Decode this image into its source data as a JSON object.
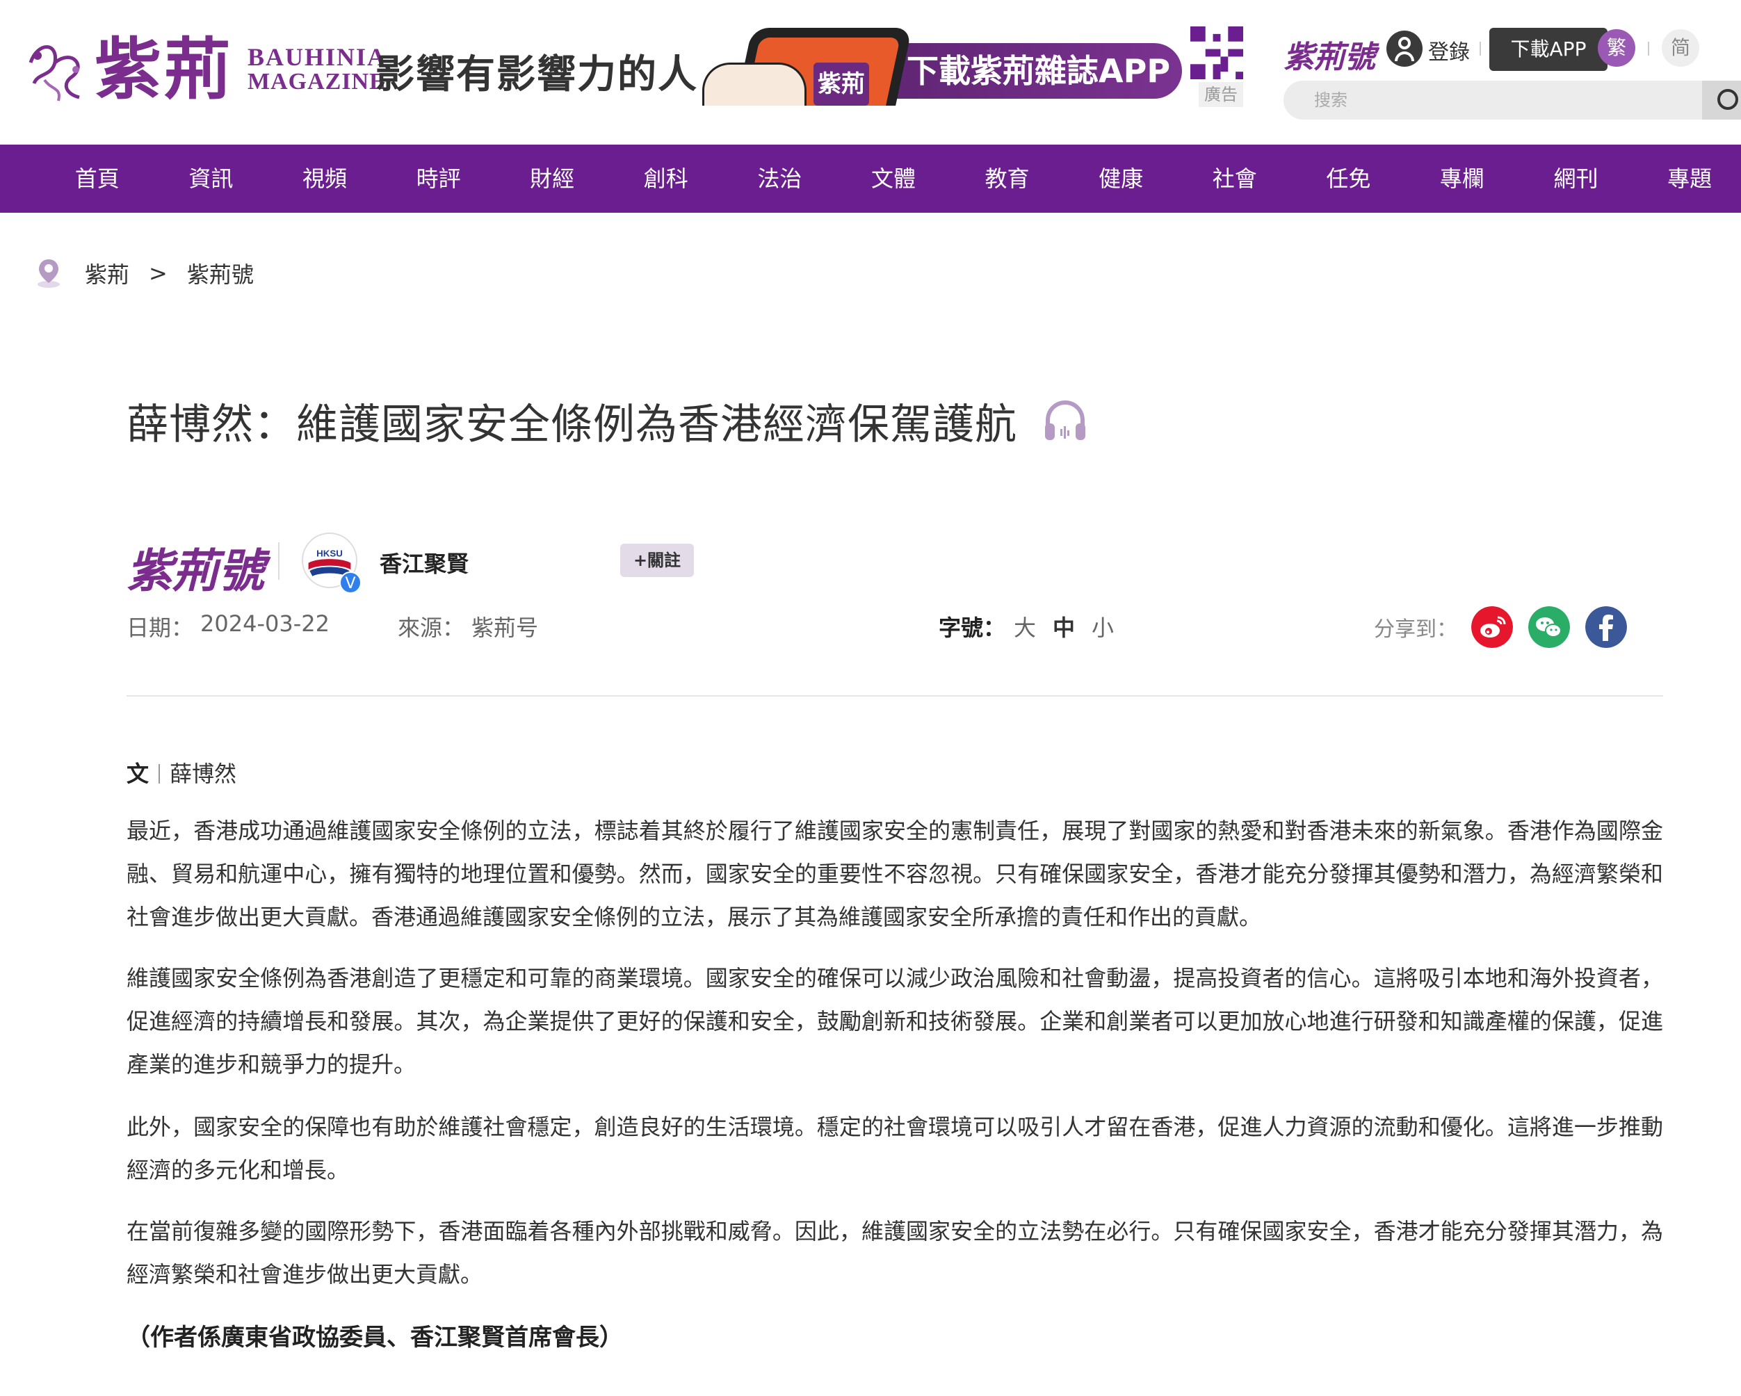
{
  "header": {
    "logo_cn": "紫荊",
    "logo_en_line1": "BAUHINIA",
    "logo_en_line2": "MAGAZINE",
    "slogan": "影響有影響力的人",
    "ad_text": "下載紫荊雜誌APP",
    "ad_phone_logo": "紫荊",
    "ad_label": "廣告",
    "zijinghao_mini": "紫荊號",
    "login_label": "登錄",
    "download_app_label": "下載APP",
    "lang_traditional": "繁",
    "lang_simplified": "简",
    "search_placeholder": "搜索"
  },
  "nav": {
    "items": [
      "首頁",
      "資訊",
      "視頻",
      "時評",
      "財經",
      "創科",
      "法治",
      "文體",
      "教育",
      "健康",
      "社會",
      "任免",
      "專欄",
      "網刊",
      "專題"
    ]
  },
  "breadcrumb": {
    "items": [
      "紫荊",
      "紫荊號"
    ],
    "separator": ">"
  },
  "article": {
    "title": "薛博然：維護國家安全條例為香港經濟保駕護航",
    "channel_logo": "紫荊號",
    "author_name": "香江聚賢",
    "avatar_text": "HKSU",
    "verified_badge": "V",
    "follow_label": "+關註",
    "date_label": "日期：",
    "date_value": "2024-03-22",
    "source_label": "來源：",
    "source_value": "紫荊号",
    "font_size_label": "字號：",
    "font_size_options": [
      "大",
      "中",
      "小"
    ],
    "share_label": "分享到：",
    "byline_prefix": "文",
    "byline_author": "薛博然",
    "paragraphs": [
      "最近，香港成功通過維護國家安全條例的立法，標誌着其終於履行了維護國家安全的憲制責任，展現了對國家的熱愛和對香港未來的新氣象。香港作為國際金融、貿易和航運中心，擁有獨特的地理位置和優勢。然而，國家安全的重要性不容忽視。只有確保國家安全，香港才能充分發揮其優勢和潛力，為經濟繁榮和社會進步做出更大貢獻。香港通過維護國家安全條例的立法，展示了其為維護國家安全所承擔的責任和作出的貢獻。",
      "維護國家安全條例為香港創造了更穩定和可靠的商業環境。國家安全的確保可以減少政治風險和社會動盪，提高投資者的信心。這將吸引本地和海外投資者，促進經濟的持續增長和發展。其次，為企業提供了更好的保護和安全，鼓勵創新和技術發展。企業和創業者可以更加放心地進行研發和知識產權的保護，促進產業的進步和競爭力的提升。",
      "此外，國家安全的保障也有助於維護社會穩定，創造良好的生活環境。穩定的社會環境可以吸引人才留在香港，促進人力資源的流動和優化。這將進一步推動經濟的多元化和增長。",
      "在當前復雜多變的國際形勢下，香港面臨着各種內外部挑戰和威脅。因此，維護國家安全的立法勢在必行。只有確保國家安全，香港才能充分發揮其潛力，為經濟繁榮和社會進步做出更大貢獻。"
    ],
    "author_note": "（作者係廣東省政協委員、香江聚賢首席會長）"
  },
  "colors": {
    "brand_purple": "#6b1e8f",
    "logo_purple": "#7b2d8e",
    "weibo_red": "#e6162d",
    "wechat_green": "#2aae67",
    "facebook_blue": "#3b5998"
  }
}
